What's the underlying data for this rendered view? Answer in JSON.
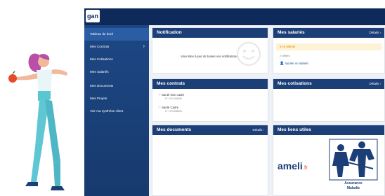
{
  "brand": {
    "logo_text": "gan"
  },
  "sidebar": {
    "items": [
      {
        "label": "Tableau de bord",
        "active": true,
        "chevron": false
      },
      {
        "label": "Mes Contrats",
        "active": false,
        "chevron": true
      },
      {
        "label": "Mes Cotisations",
        "active": false,
        "chevron": false
      },
      {
        "label": "Mes Salariés",
        "active": false,
        "chevron": false
      },
      {
        "label": "Mes Documents",
        "active": false,
        "chevron": false
      },
      {
        "label": "Mes Projets",
        "active": false,
        "chevron": false
      },
      {
        "label": "Voir ma synthèse client",
        "active": false,
        "chevron": false
      }
    ]
  },
  "cards": {
    "notification": {
      "title": "Notification",
      "message": "Vous êtes à jour de toutes vos notifications."
    },
    "salaries": {
      "title": "Mes salariés",
      "details": "Détails ›",
      "pending": "3 en attente",
      "affiliated": "2 affiliés",
      "add": "Ajouter un salarié"
    },
    "contrats": {
      "title": "Mes contrats",
      "items": [
        {
          "name": "Santé Non cadre",
          "ref": "N° 170/1454060"
        },
        {
          "name": "Santé Cadre",
          "ref": "N° 170/1508060"
        }
      ]
    },
    "cotisations": {
      "title": "Mes cotisations",
      "details": "Détails ›"
    },
    "documents": {
      "title": "Mes documents",
      "details": "Détails ›"
    },
    "liens": {
      "title": "Mes liens utiles",
      "ameli": "ameli",
      "ameli_suffix": ".fr",
      "assurance": "Assurance",
      "maladie": "Maladie"
    }
  },
  "colors": {
    "navy": "#0e2a5a",
    "sidebar": "#1d4784",
    "accent_orange": "#d78a00",
    "pending_bg": "#fdf2d3"
  }
}
